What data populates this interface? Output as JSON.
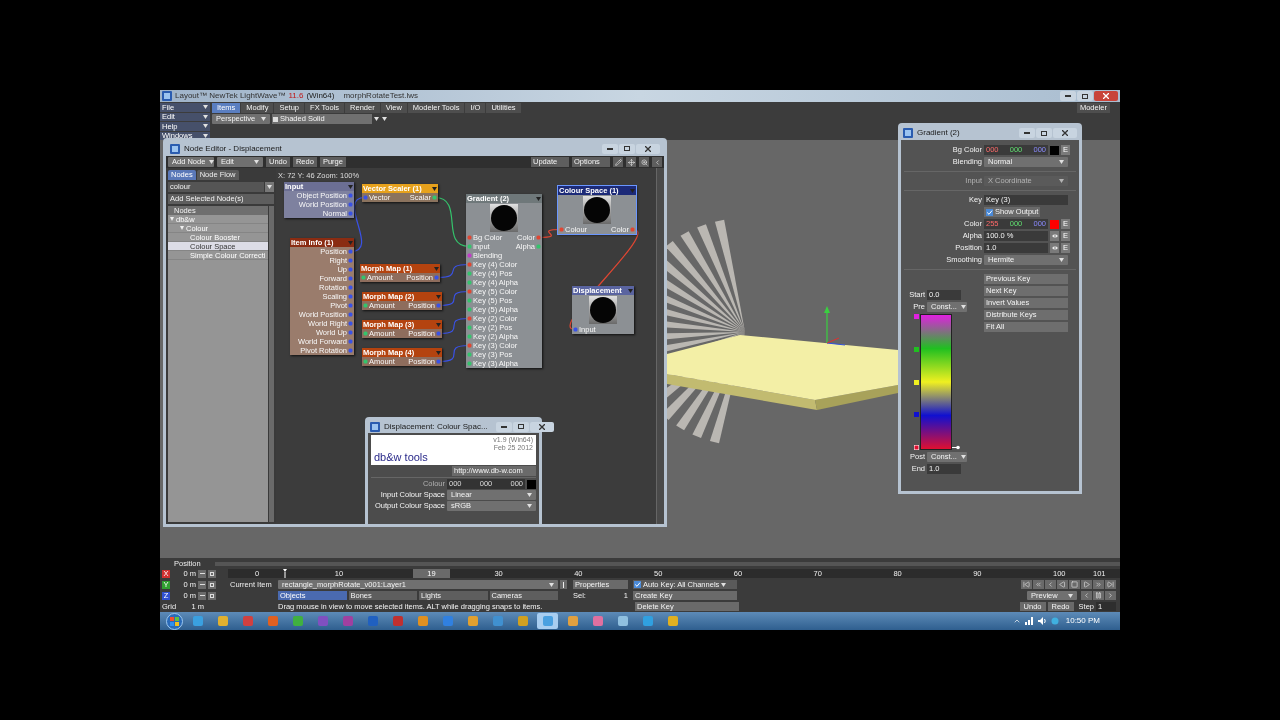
{
  "window": {
    "app": "Layout™ NewTek LightWave™",
    "version": "11.6",
    "platform": "(Win64)",
    "file": "morphRotateTest.lws",
    "modeler": "Modeler"
  },
  "menu": [
    "File",
    "Edit",
    "Help",
    "Windows"
  ],
  "tabs": [
    {
      "label": "Items",
      "selected": true
    },
    {
      "label": "Modify",
      "selected": false
    },
    {
      "label": "Setup",
      "selected": false
    },
    {
      "label": "FX Tools",
      "selected": false
    },
    {
      "label": "Render",
      "selected": false
    },
    {
      "label": "View",
      "selected": false
    },
    {
      "label": "Modeler Tools",
      "selected": false
    },
    {
      "label": "I/O",
      "selected": false
    },
    {
      "label": "Utilities",
      "selected": false
    }
  ],
  "view": {
    "projection": "Perspective",
    "shading": "Shaded Solid"
  },
  "node_editor": {
    "title": "Node Editor - Displacement",
    "toolbar_left": [
      "Add Node",
      "Edit"
    ],
    "toolbar_buttons": [
      "Undo",
      "Redo",
      "Purge"
    ],
    "toolbar_right": [
      "Update",
      "Options"
    ],
    "status": "X: 72 Y: 46 Zoom: 100%",
    "side_tabs": [
      {
        "label": "Nodes",
        "selected": true
      },
      {
        "label": "Node Flow",
        "selected": false
      }
    ],
    "search": "colour",
    "add_button": "Add Selected Node(s)",
    "tree_header": "Nodes",
    "tree": [
      {
        "label": "db&w",
        "expanded": true,
        "selected": false,
        "children": [
          {
            "label": "Colour",
            "expanded": true,
            "selected": false,
            "children": [
              {
                "label": "Colour Booster",
                "selected": false
              },
              {
                "label": "Colour Space",
                "selected": true
              },
              {
                "label": "Simple Colour Correcti",
                "selected": false
              }
            ]
          }
        ]
      }
    ],
    "nodes": [
      {
        "title": "Input",
        "kind": "input",
        "preview": false,
        "selected": false,
        "rows": [
          {
            "out": {
              "label": "Object Position",
              "color": "#3a52e6"
            }
          },
          {
            "out": {
              "label": "World Position",
              "color": "#3a52e6"
            }
          },
          {
            "out": {
              "label": "Normal",
              "color": "#3a52e6"
            }
          }
        ]
      },
      {
        "title": "Vector Scaler (1)",
        "kind": "math",
        "preview": false,
        "selected": false,
        "rows": [
          {
            "in": {
              "label": "Vector",
              "color": "#3a52e6"
            },
            "out": {
              "label": "Scalar",
              "color": "#34c46c"
            }
          }
        ]
      },
      {
        "title": "Item Info (1)",
        "kind": "item",
        "preview": false,
        "selected": false,
        "rows": [
          {
            "out": {
              "label": "Position",
              "color": "#3a52e6"
            }
          },
          {
            "out": {
              "label": "Right",
              "color": "#3a52e6"
            }
          },
          {
            "out": {
              "label": "Up",
              "color": "#3a52e6"
            }
          },
          {
            "out": {
              "label": "Forward",
              "color": "#3a52e6"
            }
          },
          {
            "out": {
              "label": "Rotation",
              "color": "#3a52e6"
            }
          },
          {
            "out": {
              "label": "Scaling",
              "color": "#3a52e6"
            }
          },
          {
            "out": {
              "label": "Pivot",
              "color": "#3a52e6"
            }
          },
          {
            "out": {
              "label": "World Position",
              "color": "#3a52e6"
            }
          },
          {
            "out": {
              "label": "World Right",
              "color": "#3a52e6"
            }
          },
          {
            "out": {
              "label": "World Up",
              "color": "#3a52e6"
            }
          },
          {
            "out": {
              "label": "World Forward",
              "color": "#3a52e6"
            }
          },
          {
            "out": {
              "label": "Pivot Rotation",
              "color": "#3a52e6"
            }
          }
        ]
      },
      {
        "title": "Morph Map (1)",
        "kind": "morph",
        "preview": false,
        "selected": false,
        "rows": [
          {
            "in": {
              "label": "Amount",
              "color": "#34c46c"
            },
            "out": {
              "label": "Position",
              "color": "#3a52e6"
            }
          }
        ]
      },
      {
        "title": "Morph Map (2)",
        "kind": "morph",
        "preview": false,
        "selected": false,
        "rows": [
          {
            "in": {
              "label": "Amount",
              "color": "#34c46c"
            },
            "out": {
              "label": "Position",
              "color": "#3a52e6"
            }
          }
        ]
      },
      {
        "title": "Morph Map (3)",
        "kind": "morph",
        "preview": false,
        "selected": false,
        "rows": [
          {
            "in": {
              "label": "Amount",
              "color": "#34c46c"
            },
            "out": {
              "label": "Position",
              "color": "#3a52e6"
            }
          }
        ]
      },
      {
        "title": "Morph Map (4)",
        "kind": "morph",
        "preview": false,
        "selected": false,
        "rows": [
          {
            "in": {
              "label": "Amount",
              "color": "#34c46c"
            },
            "out": {
              "label": "Position",
              "color": "#3a52e6"
            }
          }
        ]
      },
      {
        "title": "Gradient (2)",
        "kind": "texture",
        "preview": true,
        "selected": false,
        "rows": [
          {
            "in": {
              "label": "Bg Color",
              "color": "#e04632"
            },
            "out": {
              "label": "Color",
              "color": "#e04632"
            }
          },
          {
            "in": {
              "label": "Input",
              "color": "#34c46c"
            },
            "out": {
              "label": "Alpha",
              "color": "#34c46c"
            }
          },
          {
            "in": {
              "label": "Blending",
              "color": "#c23ac8"
            }
          },
          {
            "in": {
              "label": "Key (4) Color",
              "color": "#e04632"
            }
          },
          {
            "in": {
              "label": "Key (4) Pos",
              "color": "#34c46c"
            }
          },
          {
            "in": {
              "label": "Key (4) Alpha",
              "color": "#34c46c"
            }
          },
          {
            "in": {
              "label": "Key (5) Color",
              "color": "#e04632"
            }
          },
          {
            "in": {
              "label": "Key (5) Pos",
              "color": "#34c46c"
            }
          },
          {
            "in": {
              "label": "Key (5) Alpha",
              "color": "#34c46c"
            }
          },
          {
            "in": {
              "label": "Key (2) Color",
              "color": "#e04632"
            }
          },
          {
            "in": {
              "label": "Key (2) Pos",
              "color": "#34c46c"
            }
          },
          {
            "in": {
              "label": "Key (2) Alpha",
              "color": "#34c46c"
            }
          },
          {
            "in": {
              "label": "Key (3) Color",
              "color": "#e04632"
            }
          },
          {
            "in": {
              "label": "Key (3) Pos",
              "color": "#34c46c"
            }
          },
          {
            "in": {
              "label": "Key (3) Alpha",
              "color": "#34c46c"
            }
          }
        ]
      },
      {
        "title": "Colour Space (1)",
        "kind": "colour",
        "preview": true,
        "selected": true,
        "rows": [
          {
            "in": {
              "label": "Colour",
              "color": "#e04632"
            },
            "out": {
              "label": "Color",
              "color": "#e04632"
            }
          }
        ]
      },
      {
        "title": "Displacement",
        "kind": "output",
        "preview": true,
        "selected": false,
        "rows": [
          {
            "in": {
              "label": "Input",
              "color": "#3a52e6"
            }
          }
        ]
      }
    ]
  },
  "colour_space_dialog": {
    "title": "Displacement: Colour Spac...",
    "logo": "db&w tools",
    "version": "v1.9 (Win64)",
    "date": "Feb 25 2012",
    "url": "http://www.db-w.com",
    "colour": {
      "label": "Colour",
      "disabled": true,
      "values": [
        "000",
        "000",
        "000"
      ],
      "color": "#000000"
    },
    "fields": [
      {
        "label": "Input Colour Space",
        "value": "Linear"
      },
      {
        "label": "Output Colour Space",
        "value": "sRGB"
      }
    ]
  },
  "gradient_panel": {
    "title": "Gradient (2)",
    "bg_color": {
      "label": "Bg Color",
      "values": [
        "000",
        "000",
        "000"
      ],
      "color": "#000000",
      "button": "E"
    },
    "blending": {
      "label": "Blending",
      "value": "Normal"
    },
    "input": {
      "label": "Input",
      "value": "X Coordinate",
      "disabled": true
    },
    "key": {
      "label": "Key",
      "value": "Key (3)"
    },
    "show_output": {
      "label": "Show Output",
      "checked": true
    },
    "color": {
      "label": "Color",
      "values": [
        "255",
        "000",
        "000"
      ],
      "color": "#ff0000",
      "button": "E"
    },
    "alpha": {
      "label": "Alpha",
      "value": "100.0 %",
      "button": "E"
    },
    "position": {
      "label": "Position",
      "value": "1.0",
      "button": "E"
    },
    "smoothing": {
      "label": "Smoothing",
      "value": "Hermite"
    },
    "actions": [
      "Previous Key",
      "Next Key",
      "Invert Values",
      "Distribute Keys",
      "Fit All"
    ],
    "start": {
      "label": "Start",
      "value": "0.0"
    },
    "pre": {
      "label": "Pre",
      "value": "Const..."
    },
    "post": {
      "label": "Post",
      "value": "Const..."
    },
    "end": {
      "label": "End",
      "value": "1.0"
    },
    "keys": [
      {
        "color": "#e020e0",
        "selected": false
      },
      {
        "color": "#20c020",
        "selected": false
      },
      {
        "color": "#f0f020",
        "selected": false
      },
      {
        "color": "#1010d0",
        "selected": false
      },
      {
        "color": "#e01030",
        "selected": true
      }
    ]
  },
  "timeline": {
    "label": "Position",
    "axes": [
      {
        "kind": "axis",
        "label": "X",
        "value": "0 m",
        "color": "#d03030"
      },
      {
        "kind": "axis",
        "label": "Y",
        "value": "0 m",
        "color": "#30a030"
      },
      {
        "kind": "axis",
        "label": "Z",
        "value": "0 m",
        "color": "#3050d0"
      },
      {
        "kind": "grid",
        "label": "Grid",
        "value": "1 m"
      }
    ],
    "ruler": {
      "labels": [
        "0",
        "10",
        "30",
        "40",
        "50",
        "60",
        "70",
        "80",
        "90",
        "100"
      ],
      "end": "101",
      "thumb": "19"
    },
    "current_item": {
      "label": "Current Item",
      "value": "rectangle_morphRotate_v001:Layer1"
    },
    "properties": "Properties",
    "sel": {
      "label": "Sel:",
      "value": "1"
    },
    "auto_key": {
      "label": "Auto Key: All Channels",
      "checked": true
    },
    "item_types": [
      {
        "label": "Objects",
        "selected": true
      },
      {
        "label": "Bones",
        "selected": false
      },
      {
        "label": "Lights",
        "selected": false
      },
      {
        "label": "Cameras",
        "selected": false
      }
    ],
    "status": "Drag mouse in view to move selected items. ALT while dragging snaps to items.",
    "create_key": "Create Key",
    "delete_key": "Delete Key",
    "preview": "Preview",
    "undo": "Undo",
    "redo": "Redo",
    "step": {
      "label": "Step",
      "value": "1"
    }
  },
  "taskbar": {
    "apps": [
      {
        "selected": false
      },
      {
        "selected": false
      },
      {
        "selected": false
      },
      {
        "selected": false
      },
      {
        "selected": false
      },
      {
        "selected": false
      },
      {
        "selected": false
      },
      {
        "selected": false
      },
      {
        "selected": false
      },
      {
        "selected": false
      },
      {
        "selected": false
      },
      {
        "selected": false
      },
      {
        "selected": false
      },
      {
        "selected": false
      },
      {
        "selected": true
      },
      {
        "selected": false
      },
      {
        "selected": false
      },
      {
        "selected": false
      },
      {
        "selected": false
      },
      {
        "selected": false
      }
    ],
    "clock": "10:50 PM"
  }
}
